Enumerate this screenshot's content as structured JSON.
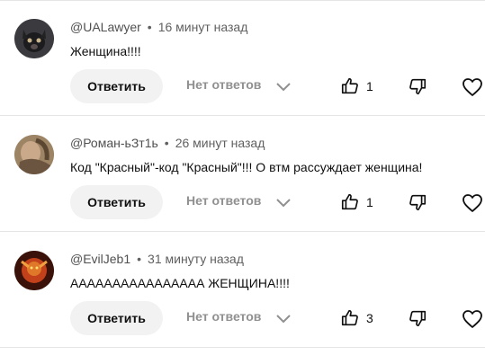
{
  "comments": [
    {
      "author": "@UALawyer",
      "time": "16 минут назад",
      "text": "Женщина!!!!",
      "reply_label": "Ответить",
      "replies_label": "Нет ответов",
      "likes": "1"
    },
    {
      "author": "@Роман-ьЗт1ь",
      "time": "26 минут назад",
      "text": "Код \"Красный\"-код \"Красный\"!!! О втм рассуждает женщина!",
      "reply_label": "Ответить",
      "replies_label": "Нет ответов",
      "likes": "1"
    },
    {
      "author": "@EvilJeb1",
      "time": "31 минуту назад",
      "text": "АААААААААААААААА ЖЕНЩИНА!!!!",
      "reply_label": "Ответить",
      "replies_label": "Нет ответов",
      "likes": "3"
    }
  ],
  "meta_separator": "•",
  "icons": {
    "expand": "chevron-down-icon",
    "like": "thumb-up-icon",
    "dislike": "thumb-down-icon",
    "heart": "heart-icon"
  },
  "colors": {
    "button_bg": "#f2f2f2",
    "muted_text": "#606060",
    "separator": "#e5e5e5"
  }
}
